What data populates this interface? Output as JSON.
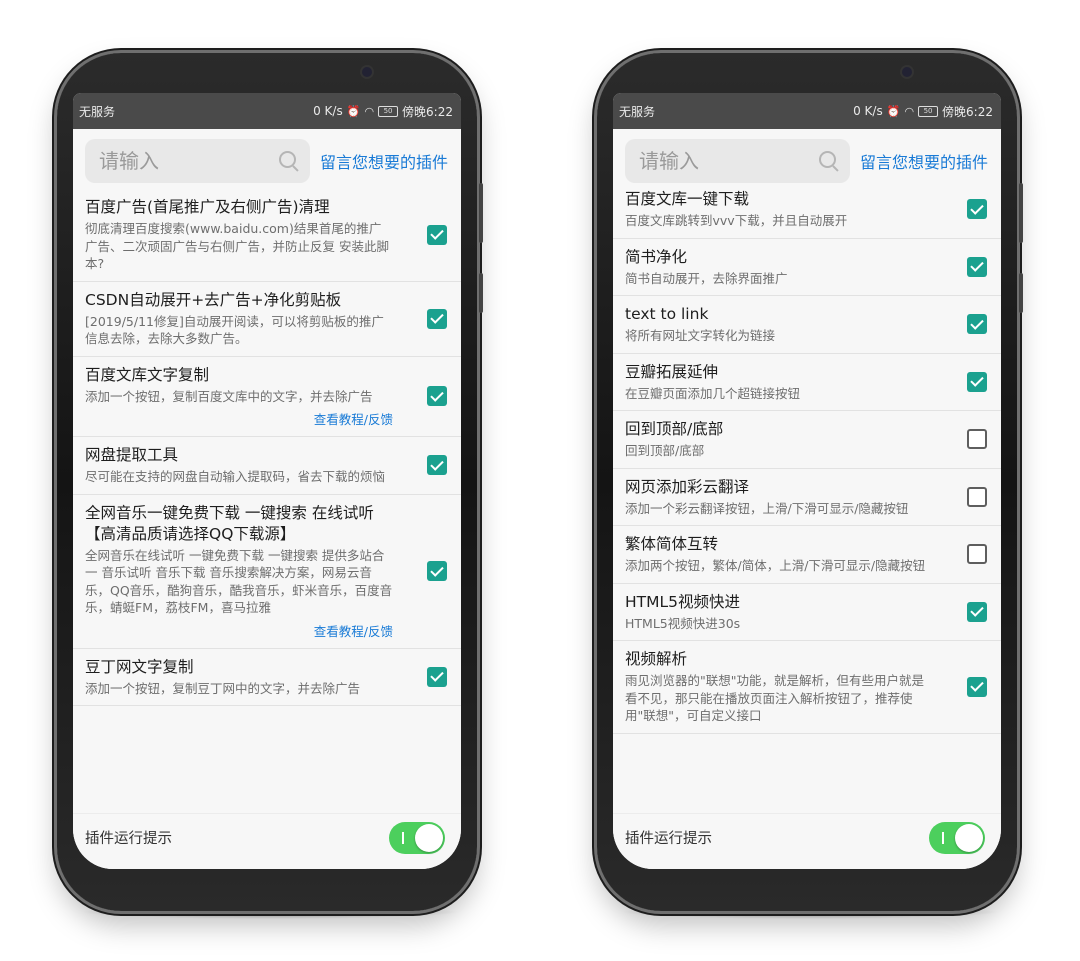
{
  "status": {
    "carrier": "无服务",
    "speed": "0 K/s",
    "battery": "50",
    "time": "傍晚6:22"
  },
  "search": {
    "placeholder": "请输入",
    "request_link": "留言您想要的插件"
  },
  "footer": {
    "label": "插件运行提示",
    "toggle_on": true
  },
  "left_list": [
    {
      "title": "百度广告(首尾推广及右侧广告)清理",
      "desc": "彻底清理百度搜索(www.baidu.com)结果首尾的推广广告、二次顽固广告与右侧广告，并防止反复 安装此脚本?",
      "checked": true,
      "link": ""
    },
    {
      "title": "CSDN自动展开+去广告+净化剪贴板",
      "desc": "[2019/5/11修复]自动展开阅读，可以将剪贴板的推广信息去除，去除大多数广告。",
      "checked": true,
      "link": ""
    },
    {
      "title": "百度文库文字复制",
      "desc": "添加一个按钮，复制百度文库中的文字，并去除广告",
      "checked": true,
      "link": "查看教程/反馈"
    },
    {
      "title": "网盘提取工具",
      "desc": "尽可能在支持的网盘自动输入提取码，省去下载的烦恼",
      "checked": true,
      "link": ""
    },
    {
      "title": "全网音乐一键免费下载 一键搜索 在线试听【高清品质请选择QQ下载源】",
      "desc": "全网音乐在线试听 一键免费下载 一键搜索 提供多站合一 音乐试听 音乐下载 音乐搜索解决方案，网易云音乐，QQ音乐，酷狗音乐，酷我音乐，虾米音乐，百度音乐，蜻蜓FM，荔枝FM，喜马拉雅",
      "checked": true,
      "link": "查看教程/反馈"
    },
    {
      "title": "豆丁网文字复制",
      "desc": "添加一个按钮，复制豆丁网中的文字，并去除广告",
      "checked": true,
      "link": ""
    }
  ],
  "right_list": [
    {
      "title": "百度文库一键下载",
      "desc": "百度文库跳转到vvv下载，并且自动展开",
      "checked": true
    },
    {
      "title": "简书净化",
      "desc": "简书自动展开，去除界面推广",
      "checked": true
    },
    {
      "title": "text to link",
      "desc": "将所有网址文字转化为链接",
      "checked": true
    },
    {
      "title": "豆瓣拓展延伸",
      "desc": "在豆瓣页面添加几个超链接按钮",
      "checked": true
    },
    {
      "title": "回到顶部/底部",
      "desc": "回到顶部/底部",
      "checked": false
    },
    {
      "title": "网页添加彩云翻译",
      "desc": "添加一个彩云翻译按钮，上滑/下滑可显示/隐藏按钮",
      "checked": false
    },
    {
      "title": "繁体简体互转",
      "desc": "添加两个按钮，繁体/简体，上滑/下滑可显示/隐藏按钮",
      "checked": false
    },
    {
      "title": "HTML5视频快进",
      "desc": "HTML5视频快进30s",
      "checked": true
    },
    {
      "title": "视频解析",
      "desc": "雨见浏览器的\"联想\"功能，就是解析，但有些用户就是看不见，那只能在播放页面注入解析按钮了，推荐使用\"联想\"，可自定义接口",
      "checked": true
    }
  ],
  "colors": {
    "checkbox_on": "#1ba18f",
    "toggle_on": "#4ccf5d",
    "link": "#1a7bd6",
    "statusbar": "#4a4a4a"
  }
}
